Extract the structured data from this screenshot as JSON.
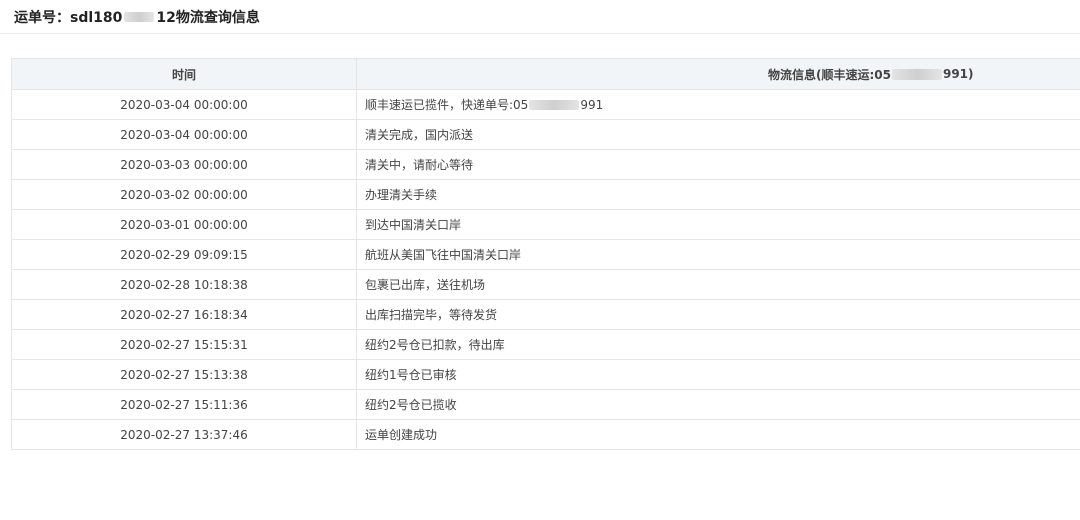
{
  "header": {
    "title_prefix": "运单号：sdl180",
    "title_suffix": "12物流查询信息"
  },
  "table": {
    "col_time": "时间",
    "col_info_prefix": "物流信息(顺丰速运:05",
    "col_info_suffix": "991)",
    "first_info_prefix": "顺丰速运已揽件，快递单号:05",
    "first_info_suffix": "991",
    "rows": [
      {
        "time": "2020-03-04 00:00:00"
      },
      {
        "time": "2020-03-04 00:00:00",
        "info": "清关完成，国内派送"
      },
      {
        "time": "2020-03-03 00:00:00",
        "info": "清关中，请耐心等待"
      },
      {
        "time": "2020-03-02 00:00:00",
        "info": "办理清关手续"
      },
      {
        "time": "2020-03-01 00:00:00",
        "info": "到达中国清关口岸"
      },
      {
        "time": "2020-02-29 09:09:15",
        "info": "航班从美国飞往中国清关口岸"
      },
      {
        "time": "2020-02-28 10:18:38",
        "info": "包裹已出库，送往机场"
      },
      {
        "time": "2020-02-27 16:18:34",
        "info": "出库扫描完毕，等待发货"
      },
      {
        "time": "2020-02-27 15:15:31",
        "info": "纽约2号仓已扣款，待出库"
      },
      {
        "time": "2020-02-27 15:13:38",
        "info": "纽约1号仓已审核"
      },
      {
        "time": "2020-02-27 15:11:36",
        "info": "纽约2号仓已揽收"
      },
      {
        "time": "2020-02-27 13:37:46",
        "info": "运单创建成功"
      }
    ]
  }
}
